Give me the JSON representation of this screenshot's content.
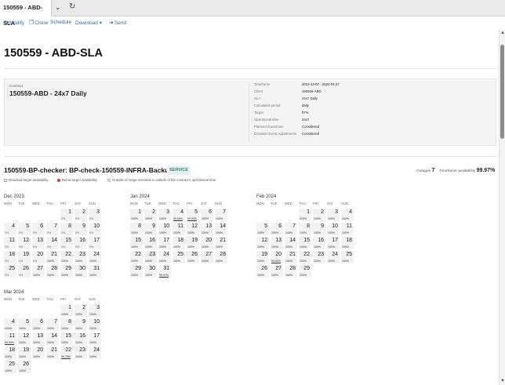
{
  "tab": {
    "title": "150559 - ABD-SLA"
  },
  "toolbar": {
    "modify": "Modify",
    "clone": "Clone",
    "schedule": "Schedule",
    "download": "Download",
    "send": "Send"
  },
  "page": {
    "title": "150559 - ABD-SLA"
  },
  "contract": {
    "label": "Contract",
    "name": "150559-ABD - 24x7 Daily",
    "details": [
      {
        "key": "Timeframe",
        "value": "2023-12-07 - 2024-03-27"
      },
      {
        "key": "Client",
        "value": "150559-ABD"
      },
      {
        "key": "SLA",
        "value": "24x7 Daily"
      },
      {
        "key": "Calculated period",
        "value": "daily"
      },
      {
        "key": "Target",
        "value": "97%"
      },
      {
        "key": "Operational time",
        "value": "24x7"
      },
      {
        "key": "Planned downtimes",
        "value": "Considered"
      },
      {
        "key": "Consider Event Adjustments",
        "value": "Considered"
      }
    ]
  },
  "check": {
    "title": "150559-BP-checker: BP-check-150559-INFRA-Backup",
    "badge": "SERVICE",
    "outages_label": "Outages",
    "outages_value": "7",
    "availability_label": "Timeframe availability",
    "availability_value": "99.97%"
  },
  "legend": {
    "reached": "Reached target availability",
    "below": "Below target availability",
    "outside": "Outside of range selected or outside of the contract's operational time"
  },
  "weekdays": [
    "MON",
    "TUE",
    "WED",
    "THU",
    "FRI",
    "SAT",
    "SUN"
  ],
  "months": [
    {
      "name": "Dec 2023",
      "offset": 4,
      "days": [
        {
          "d": "1",
          "v": "0%"
        },
        {
          "d": "2",
          "v": "0%"
        },
        {
          "d": "3",
          "v": "0%"
        },
        {
          "d": "4",
          "v": "0%"
        },
        {
          "d": "5",
          "v": "0%"
        },
        {
          "d": "6",
          "v": "0%"
        },
        {
          "d": "7",
          "v": "0%"
        },
        {
          "d": "8",
          "v": "0%"
        },
        {
          "d": "9",
          "v": "0%"
        },
        {
          "d": "10",
          "v": "0%"
        },
        {
          "d": "11",
          "v": "0%"
        },
        {
          "d": "12",
          "v": "0%"
        },
        {
          "d": "13",
          "v": "0%"
        },
        {
          "d": "14",
          "v": "0%"
        },
        {
          "d": "15",
          "v": "0%"
        },
        {
          "d": "16",
          "v": "0%"
        },
        {
          "d": "17",
          "v": "0%"
        },
        {
          "d": "18",
          "v": "0%"
        },
        {
          "d": "19",
          "v": "0%"
        },
        {
          "d": "20",
          "v": "0%"
        },
        {
          "d": "21",
          "v": "100%"
        },
        {
          "d": "22",
          "v": "100%"
        },
        {
          "d": "23",
          "v": "100%"
        },
        {
          "d": "24",
          "v": "100%"
        },
        {
          "d": "25",
          "v": "0%"
        },
        {
          "d": "26",
          "v": "0%"
        },
        {
          "d": "27",
          "v": "100%"
        },
        {
          "d": "28",
          "v": "100%"
        },
        {
          "d": "29",
          "v": "100%"
        },
        {
          "d": "30",
          "v": "100%"
        },
        {
          "d": "31",
          "v": "100%"
        }
      ]
    },
    {
      "name": "Jan 2024",
      "offset": 0,
      "days": [
        {
          "d": "1",
          "v": "100%"
        },
        {
          "d": "2",
          "v": "100%"
        },
        {
          "d": "3",
          "v": "100%"
        },
        {
          "d": "4",
          "v": "99.96%"
        },
        {
          "d": "5",
          "v": "99.93%"
        },
        {
          "d": "6",
          "v": "100%"
        },
        {
          "d": "7",
          "v": "100%"
        },
        {
          "d": "8",
          "v": "100%"
        },
        {
          "d": "9",
          "v": "100%"
        },
        {
          "d": "10",
          "v": "100%"
        },
        {
          "d": "11",
          "v": "100%"
        },
        {
          "d": "12",
          "v": "100%"
        },
        {
          "d": "13",
          "v": "100%"
        },
        {
          "d": "14",
          "v": "100%"
        },
        {
          "d": "15",
          "v": "100%"
        },
        {
          "d": "16",
          "v": "100%"
        },
        {
          "d": "17",
          "v": "100%"
        },
        {
          "d": "18",
          "v": "100%"
        },
        {
          "d": "19",
          "v": "100%"
        },
        {
          "d": "20",
          "v": "100%"
        },
        {
          "d": "21",
          "v": "100%"
        },
        {
          "d": "22",
          "v": "100%"
        },
        {
          "d": "23",
          "v": "100%"
        },
        {
          "d": "24",
          "v": "100%"
        },
        {
          "d": "25",
          "v": "100%"
        },
        {
          "d": "26",
          "v": "100%"
        },
        {
          "d": "27",
          "v": "100%"
        },
        {
          "d": "28",
          "v": "100%"
        },
        {
          "d": "29",
          "v": "100%"
        },
        {
          "d": "30",
          "v": "100%"
        },
        {
          "d": "31",
          "v": "99.97%"
        }
      ]
    },
    {
      "name": "Feb 2024",
      "offset": 3,
      "days": [
        {
          "d": "1",
          "v": "100%"
        },
        {
          "d": "2",
          "v": "100%"
        },
        {
          "d": "3",
          "v": "100%"
        },
        {
          "d": "4",
          "v": "100%"
        },
        {
          "d": "5",
          "v": "100%"
        },
        {
          "d": "6",
          "v": "100%"
        },
        {
          "d": "7",
          "v": "100%"
        },
        {
          "d": "8",
          "v": "100%"
        },
        {
          "d": "9",
          "v": "100%"
        },
        {
          "d": "10",
          "v": "100%"
        },
        {
          "d": "11",
          "v": "100%"
        },
        {
          "d": "12",
          "v": "100%"
        },
        {
          "d": "13",
          "v": "100%"
        },
        {
          "d": "14",
          "v": "100%"
        },
        {
          "d": "15",
          "v": "100%"
        },
        {
          "d": "16",
          "v": "100%"
        },
        {
          "d": "17",
          "v": "100%"
        },
        {
          "d": "18",
          "v": "100%"
        },
        {
          "d": "19",
          "v": "100%"
        },
        {
          "d": "20",
          "v": "99.96%"
        },
        {
          "d": "21",
          "v": "100%"
        },
        {
          "d": "22",
          "v": "100%"
        },
        {
          "d": "23",
          "v": "100%"
        },
        {
          "d": "24",
          "v": "100%"
        },
        {
          "d": "25",
          "v": "100%"
        },
        {
          "d": "26",
          "v": "100%"
        },
        {
          "d": "27",
          "v": "100%"
        },
        {
          "d": "28",
          "v": "100%"
        },
        {
          "d": "29",
          "v": "100%"
        }
      ]
    },
    {
      "name": "Mar 2024",
      "offset": 4,
      "days": [
        {
          "d": "1",
          "v": "100%"
        },
        {
          "d": "2",
          "v": "100%"
        },
        {
          "d": "3",
          "v": "100%"
        },
        {
          "d": "4",
          "v": "100%"
        },
        {
          "d": "5",
          "v": "100%"
        },
        {
          "d": "6",
          "v": "100%"
        },
        {
          "d": "7",
          "v": "100%"
        },
        {
          "d": "8",
          "v": "100%"
        },
        {
          "d": "9",
          "v": "100%"
        },
        {
          "d": "10",
          "v": "100%"
        },
        {
          "d": "11",
          "v": "99.93%"
        },
        {
          "d": "12",
          "v": "100%"
        },
        {
          "d": "13",
          "v": "100%"
        },
        {
          "d": "14",
          "v": "100%"
        },
        {
          "d": "15",
          "v": "100%"
        },
        {
          "d": "16",
          "v": "100%"
        },
        {
          "d": "17",
          "v": "100%"
        },
        {
          "d": "18",
          "v": "100%"
        },
        {
          "d": "19",
          "v": "100%"
        },
        {
          "d": "20",
          "v": "100%"
        },
        {
          "d": "21",
          "v": "100%"
        },
        {
          "d": "22",
          "v": "99.75%"
        },
        {
          "d": "23",
          "v": "100%"
        },
        {
          "d": "24",
          "v": "100%"
        },
        {
          "d": "25",
          "v": "100%"
        },
        {
          "d": "26",
          "v": "100%"
        }
      ]
    }
  ],
  "colors": {
    "accent": "#2a6bb5",
    "below_target": "#e03a3a",
    "service_badge": "#3a8a74"
  }
}
